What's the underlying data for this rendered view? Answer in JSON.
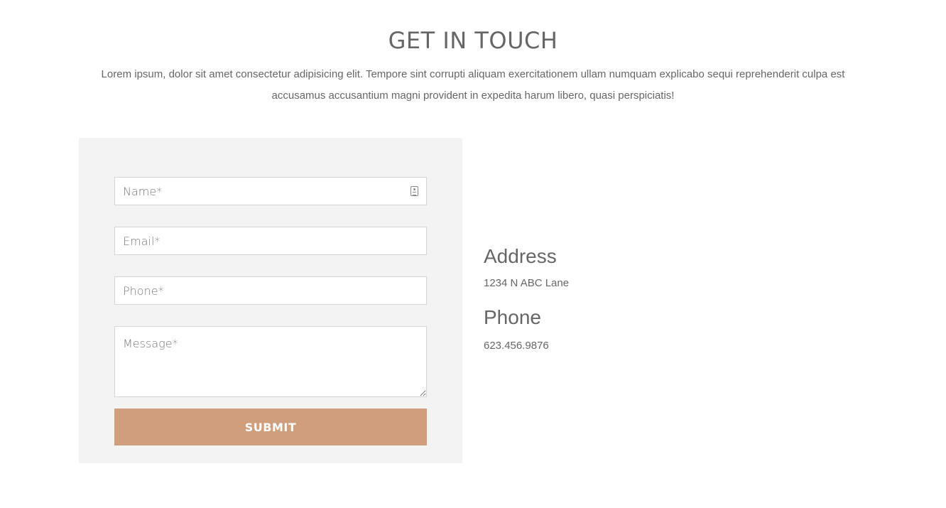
{
  "section": {
    "title": "GET IN TOUCH",
    "intro": "Lorem ipsum, dolor sit amet consectetur adipisicing elit. Tempore sint corrupti aliquam exercitationem ullam numquam explicabo sequi reprehenderit culpa est accusamus accusantium magni provident in expedita harum libero, quasi perspiciatis!"
  },
  "form": {
    "name_placeholder": "Name*",
    "email_placeholder": "Email*",
    "phone_placeholder": "Phone*",
    "message_placeholder": "Message*",
    "submit_label": "SUBMIT",
    "name_field_icon": "contact-card-icon"
  },
  "info": {
    "address_heading": "Address",
    "address_value": "1234 N ABC Lane",
    "phone_heading": "Phone",
    "phone_value": "623.456.9876"
  },
  "colors": {
    "panel_background": "#f4f3f3",
    "submit_button": "#cf9e7c",
    "text": "#666666"
  }
}
